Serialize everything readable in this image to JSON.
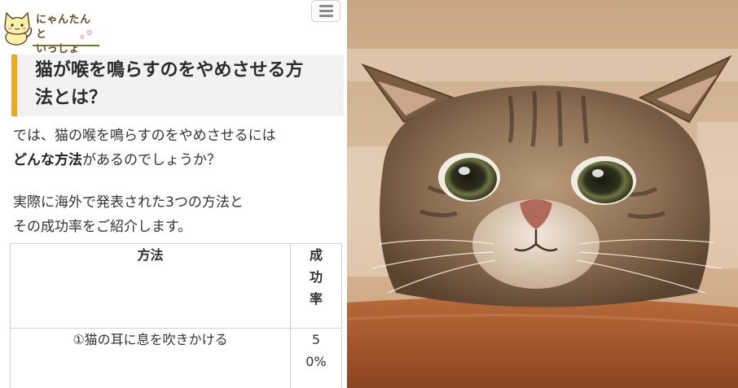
{
  "site": {
    "logo_line1": "にゃんたんと",
    "logo_line2": "いっしょ"
  },
  "article": {
    "heading_line1": "猫が喉を鳴らすのをやめさせる方",
    "heading_line2": "法とは？",
    "para1_line1": "では、猫の喉を鳴らすのをやめさせるには",
    "para1_bold": "どんな方法",
    "para1_rest": "があるのでしょうか？",
    "para2_line1": "実際に海外で発表された3つの方法と",
    "para2_line2": "その成功率をご紹介します。"
  },
  "table": {
    "headers": [
      "方法",
      "成功率"
    ],
    "rows": [
      [
        "①猫の耳に息を吹きかける",
        "50%"
      ]
    ]
  },
  "colors": {
    "accent": "#f0a81e",
    "heading_bg": "#f2f2f2",
    "logo_line": "#6b7d2a"
  },
  "photo": {
    "subject": "tabby cat peeking over wooden table"
  }
}
